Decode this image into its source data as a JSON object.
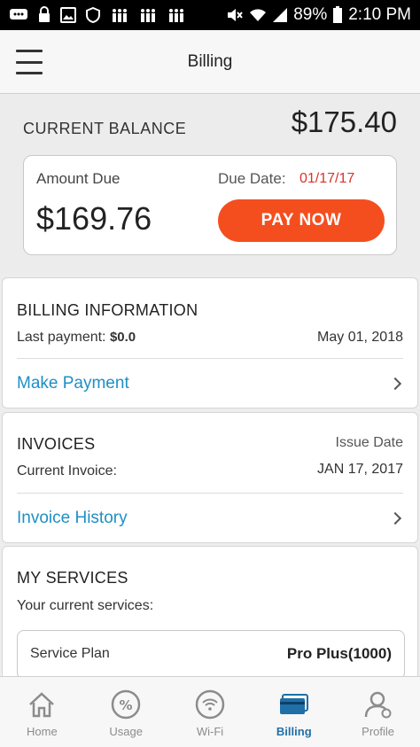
{
  "status_bar": {
    "battery": "89%",
    "time": "2:10 PM"
  },
  "toolbar": {
    "title": "Billing"
  },
  "balance": {
    "label": "CURRENT BALANCE",
    "value": "$175.40",
    "amount_due_label": "Amount Due",
    "amount_due_value": "$169.76",
    "due_date_label": "Due Date:",
    "due_date_value": "01/17/17",
    "pay_button": "PAY NOW"
  },
  "billing_info": {
    "title": "BILLING INFORMATION",
    "last_payment_label": "Last payment:",
    "last_payment_value": "$0.0",
    "last_payment_date": "May 01, 2018",
    "link": "Make Payment"
  },
  "invoices": {
    "title": "INVOICES",
    "issue_date_label": "Issue Date",
    "current_invoice_label": "Current Invoice:",
    "current_invoice_date": "JAN 17, 2017",
    "link": "Invoice History"
  },
  "services": {
    "title": "MY SERVICES",
    "subtitle": "Your current services:",
    "plan_label": "Service Plan",
    "plan_value": "Pro Plus(1000)"
  },
  "bottom_nav": {
    "items": [
      {
        "label": "Home",
        "icon": "home-icon"
      },
      {
        "label": "Usage",
        "icon": "percent-icon"
      },
      {
        "label": "Wi-Fi",
        "icon": "wifi-icon"
      },
      {
        "label": "Billing",
        "icon": "credit-card-icon"
      },
      {
        "label": "Profile",
        "icon": "profile-icon"
      }
    ],
    "active": "Billing",
    "active_color": "#1f6fa8",
    "inactive_color": "#8c8c8c"
  },
  "colors": {
    "accent": "#f44e1f",
    "link": "#1f8fc6",
    "due_date": "#d9332a"
  }
}
